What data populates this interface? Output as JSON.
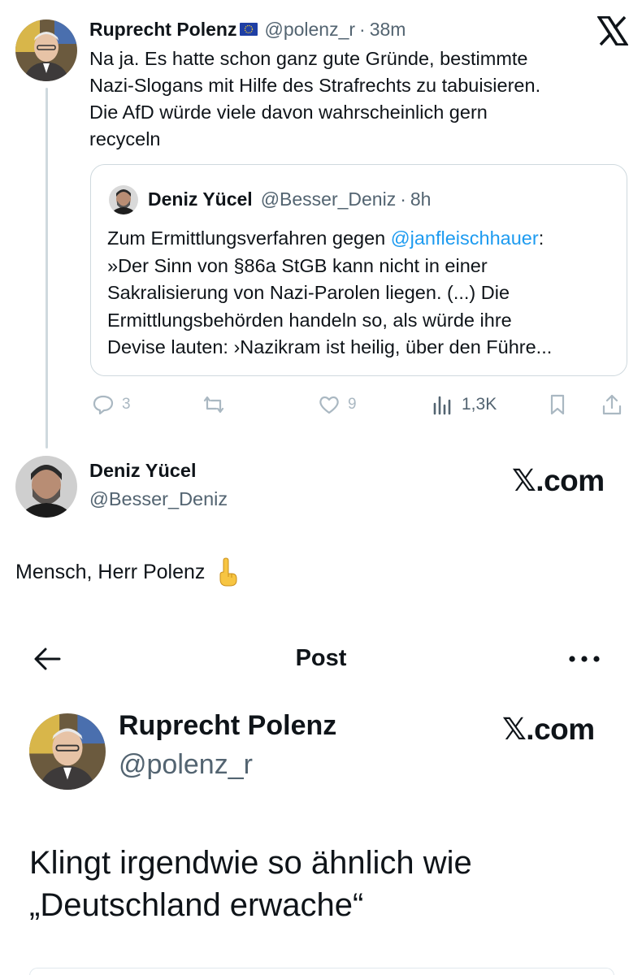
{
  "top_tweet": {
    "author_name": "Ruprecht Polenz",
    "handle": "@polenz_r",
    "time": "38m",
    "separator": "·",
    "text_lines": [
      "Na ja. Es hatte schon ganz gute Gründe, bestimmte",
      "Nazi-Slogans mit Hilfe des Strafrechts zu tabuisieren.",
      "Die AfD würde viele davon wahrscheinlich gern",
      "recyceln"
    ],
    "quoted": {
      "author_name": "Deniz Yücel",
      "handle": "@Besser_Deniz",
      "time": "8h",
      "line1_prefix": "Zum Ermittlungsverfahren gegen ",
      "line1_mention": "@janfleischhauer",
      "line1_suffix": ":",
      "lines": [
        "»Der Sinn von §86a StGB kann nicht in einer",
        "Sakralisierung von Nazi-Parolen liegen. (...) Die",
        "Ermittlungsbehörden handeln so, als würde ihre",
        "Devise lauten: ›Nazikram ist heilig, über den Führe..."
      ]
    },
    "actions": {
      "replies": "3",
      "likes": "9",
      "views": "1,3K"
    }
  },
  "second_post": {
    "author_name": "Deniz Yücel",
    "handle": "@Besser_Deniz",
    "watermark": "𝕏.com",
    "text": "Mensch, Herr Polenz"
  },
  "third_post": {
    "header_title": "Post",
    "author_name": "Ruprecht Polenz",
    "handle": "@polenz_r",
    "watermark": "𝕏.com",
    "text_lines": [
      "Klingt irgendwie so ähnlich wie",
      "„Deutschland erwache“"
    ]
  },
  "colors": {
    "text": "#0f1419",
    "secondary": "#536471",
    "mention": "#1d9bf0",
    "border": "#cfd9de"
  },
  "icons": [
    "x-logo-icon",
    "eu-flag-icon",
    "reply-icon",
    "retweet-icon",
    "like-icon",
    "views-icon",
    "bookmark-icon",
    "share-icon",
    "pointing-down-emoji-icon",
    "back-arrow-icon",
    "more-icon"
  ]
}
